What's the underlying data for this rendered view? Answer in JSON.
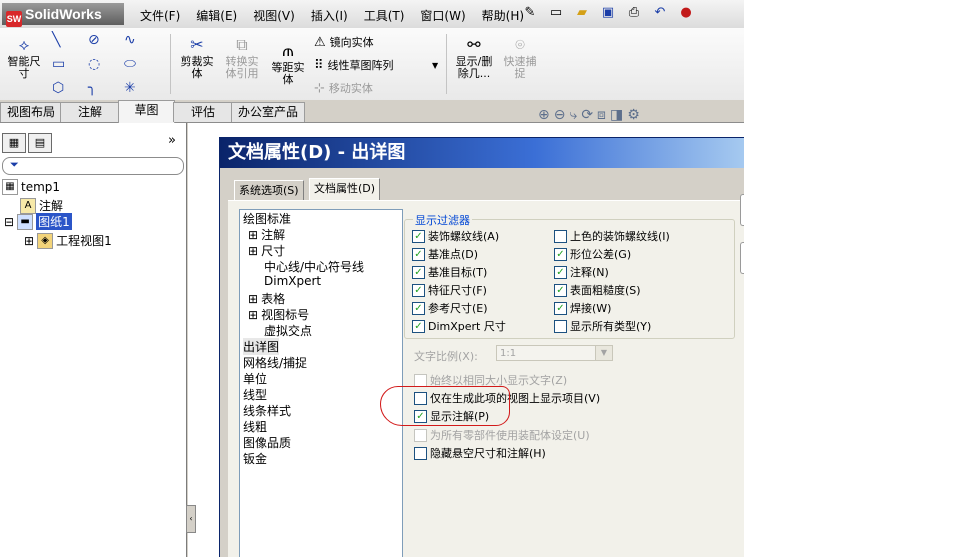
{
  "app": {
    "name": "SolidWorks",
    "logo_badge": "SW"
  },
  "menu": [
    "文件(F)",
    "编辑(E)",
    "视图(V)",
    "插入(I)",
    "工具(T)",
    "窗口(W)",
    "帮助(H)"
  ],
  "quick_icons": [
    "pin-icon",
    "new-doc-icon",
    "open-icon",
    "save-icon",
    "print-icon",
    "undo-icon",
    "traffic-light-icon"
  ],
  "command_manager": {
    "smart_dim": "智能尺寸",
    "trim": "剪裁实体",
    "convert": "转换实体引用",
    "offset": "等距实体",
    "mirror": "镜向实体",
    "linear_pattern": "线性草图阵列",
    "move": "移动实体",
    "show_delete": "显示/删除几...",
    "quick_snap": "快速捕捉"
  },
  "tabs": [
    "视图布局",
    "注解",
    "草图",
    "评估",
    "办公室产品"
  ],
  "active_tab": "草图",
  "left_panel": {
    "expand_glyph": "»",
    "tree": [
      {
        "label": "temp1",
        "indent": 0,
        "icon": "drawing-icon"
      },
      {
        "label": "注解",
        "indent": 1,
        "icon": "annotation-icon",
        "glyph": "A"
      },
      {
        "label": "图纸1",
        "indent": 1,
        "icon": "sheet-icon",
        "selected": true,
        "toggle": "⊟"
      },
      {
        "label": "工程视图1",
        "indent": 2,
        "icon": "drawing-view-icon",
        "toggle": "⊞"
      }
    ]
  },
  "dialog": {
    "title": "文档属性(D) - 出详图",
    "tab_system": "系统选项(S)",
    "tab_document": "文档属性(D)",
    "categories": [
      {
        "label": "绘图标准",
        "level": 0
      },
      {
        "label": "注解",
        "level": 1,
        "toggle": "⊞"
      },
      {
        "label": "尺寸",
        "level": 1,
        "toggle": "⊞"
      },
      {
        "label": "中心线/中心符号线",
        "level": 2
      },
      {
        "label": "DimXpert",
        "level": 2
      },
      {
        "label": "表格",
        "level": 1,
        "toggle": "⊞"
      },
      {
        "label": "视图标号",
        "level": 1,
        "toggle": "⊞"
      },
      {
        "label": "虚拟交点",
        "level": 2
      },
      {
        "label": "出详图",
        "level": 0,
        "selected": true
      },
      {
        "label": "网格线/捕捉",
        "level": 0
      },
      {
        "label": "单位",
        "level": 0
      },
      {
        "label": "线型",
        "level": 0
      },
      {
        "label": "线条样式",
        "level": 0
      },
      {
        "label": "线粗",
        "level": 0
      },
      {
        "label": "图像品质",
        "level": 0
      },
      {
        "label": "钣金",
        "level": 0
      }
    ],
    "filter_group_label": "显示过滤器",
    "filter_left": [
      {
        "label": "装饰螺纹线(A)",
        "checked": true
      },
      {
        "label": "基准点(D)",
        "checked": true
      },
      {
        "label": "基准目标(T)",
        "checked": true
      },
      {
        "label": "特征尺寸(F)",
        "checked": true
      },
      {
        "label": "参考尺寸(E)",
        "checked": true
      },
      {
        "label": "DimXpert 尺寸",
        "checked": true
      }
    ],
    "filter_right": [
      {
        "label": "上色的装饰螺纹线(I)",
        "checked": false
      },
      {
        "label": "形位公差(G)",
        "checked": true
      },
      {
        "label": "注释(N)",
        "checked": true
      },
      {
        "label": "表面粗糙度(S)",
        "checked": true
      },
      {
        "label": "焊接(W)",
        "checked": true
      },
      {
        "label": "显示所有类型(Y)",
        "checked": false
      }
    ],
    "text_scale_label": "文字比例(X):",
    "text_scale_value": "1:1",
    "options": [
      {
        "label": "始终以相同大小显示文字(Z)",
        "checked": false,
        "disabled": true
      },
      {
        "label": "仅在生成此项的视图上显示项目(V)",
        "checked": false,
        "disabled": false
      },
      {
        "label": "显示注解(P)",
        "checked": true,
        "disabled": false
      },
      {
        "label": "为所有零部件使用装配体设定(U)",
        "checked": false,
        "disabled": true
      },
      {
        "label": "隐藏悬空尺寸和注解(H)",
        "checked": false,
        "disabled": false
      }
    ]
  },
  "colors": {
    "title_blue": "#0a246a",
    "accent_blue": "#0046d5",
    "check_green": "#21a121",
    "highlight_red": "#d21a1a",
    "selection_blue": "#2b55c8"
  }
}
